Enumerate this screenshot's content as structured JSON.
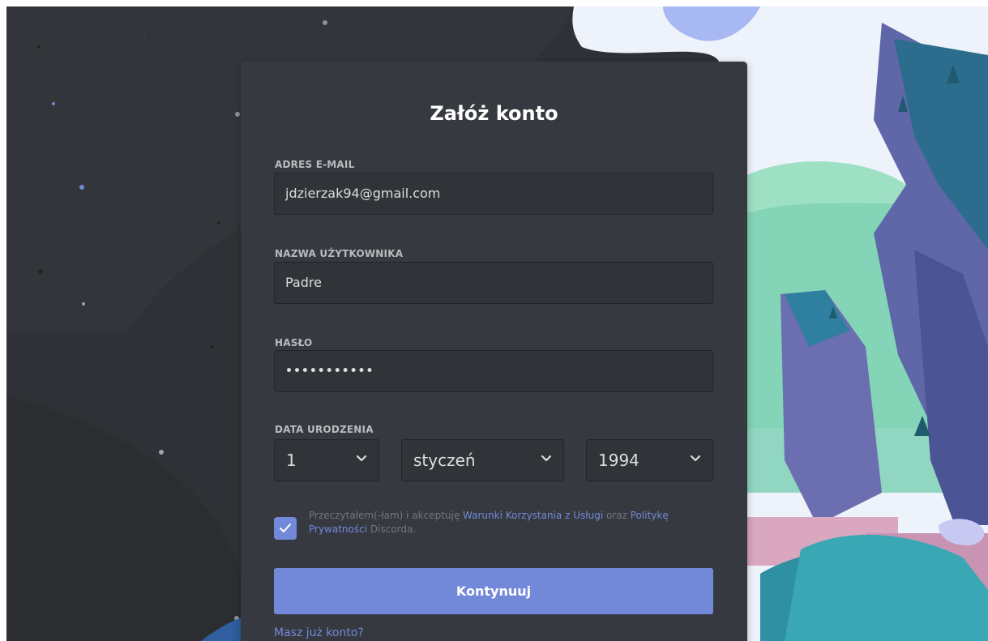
{
  "form": {
    "title": "Załóż konto",
    "email": {
      "label": "ADRES E-MAIL",
      "value": "jdzierzak94@gmail.com"
    },
    "username": {
      "label": "NAZWA UŻYTKOWNIKA",
      "value": "Padre"
    },
    "password": {
      "label": "HASŁO",
      "masked_value": "•••••••••••"
    },
    "birthdate": {
      "label": "DATA URODZENIA",
      "day": "1",
      "month": "styczeń",
      "year": "1994"
    },
    "terms": {
      "checked": true,
      "text_before": "Przeczytałem(-łam) i akceptuję ",
      "terms_link": "Warunki Korzystania z Usługi",
      "text_middle": " oraz ",
      "privacy_link": "Politykę Prywatności",
      "text_after": " Discorda."
    },
    "continue_button": "Kontynuuj",
    "login_link": "Masz już konto?"
  },
  "colors": {
    "accent": "#7289da",
    "card": "#36393f",
    "background_dark": "#2f3136",
    "input_background": "#303338"
  },
  "icons": [
    "chevron-down-icon",
    "checkmark-icon"
  ]
}
